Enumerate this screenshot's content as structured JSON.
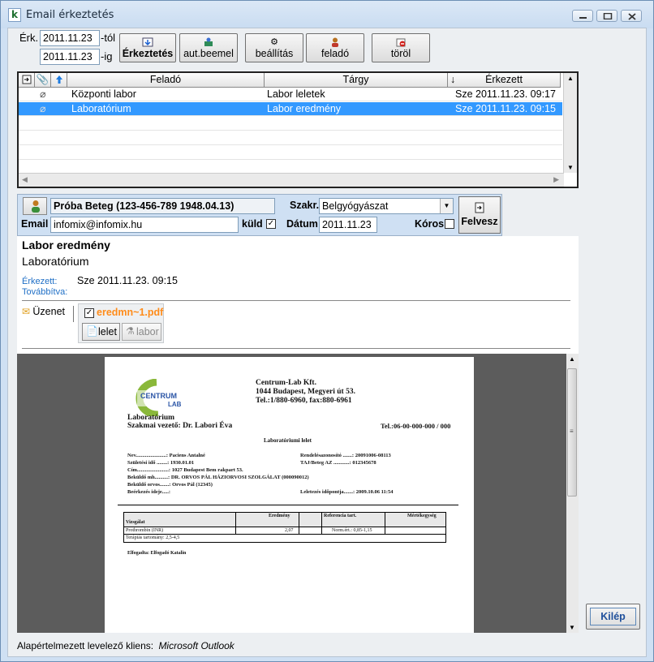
{
  "window": {
    "title": "Email érkeztetés",
    "app_icon": "k"
  },
  "filter": {
    "erk_label": "Érk.",
    "from_value": "2011.11.23",
    "from_suffix": "-tól",
    "to_value": "2011.11.23",
    "to_suffix": "-ig"
  },
  "toolbar": {
    "erkeztetes": "Érkeztetés",
    "autbeemel": "aut.beemel",
    "beallitas": "beállítás",
    "felado": "feladó",
    "torol": "töröl"
  },
  "grid": {
    "headers": {
      "felado": "Feladó",
      "targy": "Tárgy",
      "erkezett": "Érkezett"
    },
    "rows": [
      {
        "felado": "Központi labor",
        "targy": "Labor leletek",
        "erkezett": "Sze 2011.11.23. 09:17",
        "selected": false
      },
      {
        "felado": "Laboratórium",
        "targy": "Labor eredmény",
        "erkezett": "Sze 2011.11.23. 09:15",
        "selected": true
      }
    ]
  },
  "patient": {
    "name": "Próba Beteg (123-456-789 1948.04.13)",
    "szakr_label": "Szakr.",
    "szakr_value": "Belgyógyászat",
    "email_label": "Email",
    "email_value": "infomix@infomix.hu",
    "kuld_label": "küld",
    "datum_label": "Dátum",
    "datum_value": "2011.11.23",
    "koros_label": "Kóros",
    "felvesz_label": "Felvesz"
  },
  "message": {
    "subject": "Labor eredmény",
    "sender": "Laboratórium",
    "erkezett_label": "Érkezett:",
    "erkezett_value": "Sze 2011.11.23. 09:15",
    "tovabbitva_label": "Továbbítva:",
    "uzenet_tab": "Üzenet",
    "attachment_name": "eredmn~1.pdf",
    "lelet_btn": "lelet",
    "labor_btn": "labor"
  },
  "document": {
    "logo_text_1": "CENTRUM",
    "logo_text_2": "LAB",
    "company": "Centrum-Lab Kft.",
    "address": "1044 Budapest, Megyeri út 53.",
    "phone": "Tel.:1/880-6960, fax:880-6961",
    "lab_name": "Laboratórium",
    "head": "Szakmai vezető: Dr. Labori Éva",
    "tel2": "Tel.:06-00-000-000 / 000",
    "doc_title": "Laboratóriumi lelet",
    "nev_l": "Nev.......................: Paciens Antalné",
    "szul_l": "Születési idő ........: 1930.01.01",
    "cim_l": "Cím........................: 1027 Budapest Bem rakpart 53.",
    "bekuldo_l": "Beküldő mh..........: DR. ORVOS PÁL HÁZIORVOSI SZOLGÁLAT (000090012)",
    "bekuldoorv_l": "Beküldő orvos.......: Orvos Pál (12345)",
    "beerkezes_l": "Beérkezés ideje.....:",
    "rendeles_r": "Rendelésazonosító .......: 20091006-08113",
    "taj_r": "TAJ/Beteg AZ ............: 012345678",
    "leletezes_r": "Leletezés időpontja.......: 2009.10.06 11:54",
    "th_vizsgalat": "Vizsgálat",
    "th_eredmeny": "Eredmény",
    "th_referencia": "Referencia tart.",
    "th_mertekegyseg": "Mértékegység",
    "row_name": "Prothrombin (INR)",
    "row_value": "2,07",
    "row_ref": "Norm.ért.: 0,85-1,15",
    "row_note": "Terápiás tartomány: 2,5-4,5",
    "elfogadta": "Elfogadta: Elfogadó Katalin"
  },
  "exit_button": "Kilép",
  "footer": {
    "label": "Alapértelmezett levelező kliens:",
    "value": "Microsoft Outlook"
  },
  "colors": {
    "selection": "#3399ff",
    "accent_orange": "#ff8c1a",
    "link_blue": "#1f6fc6",
    "frame": "#cfe0f3"
  }
}
